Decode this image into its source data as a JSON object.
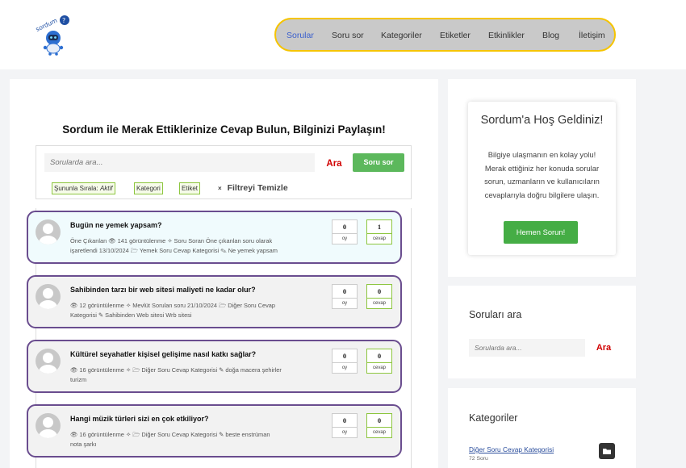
{
  "header": {
    "logo_text": "sordum",
    "nav": [
      {
        "label": "Sorular",
        "active": true
      },
      {
        "label": "Soru sor",
        "active": false
      },
      {
        "label": "Kategoriler",
        "active": false
      },
      {
        "label": "Etiketler",
        "active": false
      },
      {
        "label": "Etkinlikler",
        "active": false
      },
      {
        "label": "Blog",
        "active": false
      },
      {
        "label": "İletişim",
        "active": false
      }
    ]
  },
  "main": {
    "title": "Sordum ile Merak Ettiklerinize Cevap Bulun, Bilginizi Paylaşın!",
    "search": {
      "placeholder": "Sorularda ara...",
      "search_label": "Ara",
      "ask_label": "Soru sor"
    },
    "filters": {
      "sort_label": "Şununla Sırala:",
      "sort_value": "Aktif",
      "category_label": "Kategori",
      "tag_label": "Etiket",
      "clear_icon": "×",
      "clear_label": "Filtreyi Temizle"
    },
    "questions": [
      {
        "title": "Bugün ne yemek yapsam?",
        "meta_line1": "Öne Çıkanlan  👁 141 görüntülenme  ✧ Soru Soran Öne çıkanlan soru olarak",
        "meta_line2": "işaretlendi 13/10/2024  🗁 Yemek Soru Cevap Kategorisi  ✎ Ne yemek yapsam",
        "votes": "0",
        "votes_label": "oy",
        "answers": "1",
        "answers_label": "cevap",
        "bg": "#f0fbfd"
      },
      {
        "title": "Sahibinden tarzı bir web sitesi maliyeti ne kadar olur?",
        "meta_line1": "👁 12 görüntülenme  ✧ Mevlüt Sorulan soru 21/10/2024  🗁 Diğer Soru Cevap",
        "meta_line2": "Kategorisi  ✎ Sahibinden Web sitesi Wrb sitesi",
        "votes": "0",
        "votes_label": "oy",
        "answers": "0",
        "answers_label": "cevap",
        "bg": "#f2f2f2"
      },
      {
        "title": "Kültürel seyahatler kişisel gelişime nasıl katkı sağlar?",
        "meta_line1": "👁 16 görüntülenme  ✧  🗁 Diğer Soru Cevap Kategorisi  ✎ doğa macera şehirler",
        "meta_line2": "turizm",
        "votes": "0",
        "votes_label": "oy",
        "answers": "0",
        "answers_label": "cevap",
        "bg": "#f2f2f2"
      },
      {
        "title": "Hangi müzik türleri sizi en çok etkiliyor?",
        "meta_line1": "👁 16 görüntülenme  ✧  🗁 Diğer Soru Cevap Kategorisi  ✎ beste enstrüman",
        "meta_line2": "nota şarkı",
        "votes": "0",
        "votes_label": "oy",
        "answers": "0",
        "answers_label": "cevap",
        "bg": "#f2f2f2"
      }
    ]
  },
  "sidebar": {
    "welcome": {
      "title": "Sordum'a Hoş Geldiniz!",
      "text": "Bilgiye ulaşmanın en kolay yolu! Merak ettiğiniz her konuda sorular sorun, uzmanların ve kullanıcıların cevaplarıyla doğru bilgilere ulaşın.",
      "button": "Hemen Sorun!"
    },
    "search": {
      "title": "Soruları ara",
      "placeholder": "Sorularda ara...",
      "button": "Ara"
    },
    "categories": {
      "title": "Kategoriler",
      "items": [
        {
          "name": "Diğer Soru Cevap Kategorisi",
          "count": "72 Soru"
        }
      ]
    }
  }
}
